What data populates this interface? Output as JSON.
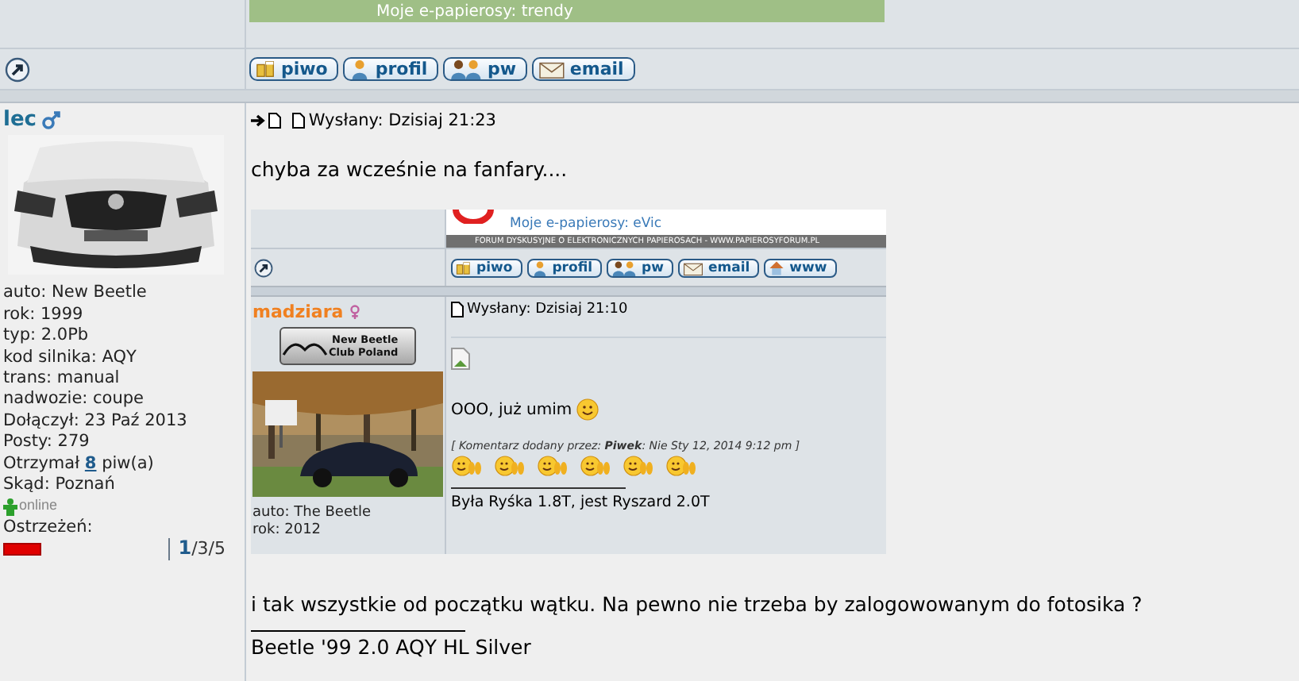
{
  "previous_post": {
    "signature_banner": "Moje e-papierosy: trendy",
    "buttons": [
      {
        "kind": "beer",
        "label": "piwo"
      },
      {
        "kind": "profile",
        "label": "profil"
      },
      {
        "kind": "pm",
        "label": "pw"
      },
      {
        "kind": "email",
        "label": "email"
      }
    ]
  },
  "post": {
    "author": "lec",
    "author_badge": {
      "kind": "male"
    },
    "profile_lines": [
      "auto: New Beetle",
      "rok: 1999",
      "typ: 2.0Pb",
      "kod silnika: AQY",
      "trans: manual",
      "nadwozie: coupe",
      "Dołączył: 23 Paź 2013",
      "Posty: 279"
    ],
    "beers": {
      "prefix": "Otrzymał",
      "count": "8",
      "suffix": "piw(a)"
    },
    "location": "Skąd: Poznań",
    "status": "online",
    "warnings_label": "Ostrzeżeń:",
    "warnings_count": "**1**/3/5",
    "posted": "Wysłany: Dzisiaj 21:23",
    "body_before": "chyba za wcześnie na fanfary....",
    "embedded_screenshot": {
      "banner_text": "Moje e-papierosy: eVic",
      "banner_footer": "FORUM DYSKUSYJNE O ELEKTRONICZNYCH PAPIEROSACH - WWW.PAPIEROSYFORUM.PL",
      "buttons": [
        {
          "kind": "beer",
          "label": "piwo"
        },
        {
          "kind": "profile",
          "label": "profil"
        },
        {
          "kind": "pm",
          "label": "pw"
        },
        {
          "kind": "email",
          "label": "email"
        },
        {
          "kind": "www",
          "label": "www"
        }
      ],
      "author": "madziara",
      "author_badge": {
        "kind": "female"
      },
      "club_badge": [
        "New Beetle",
        "Club Poland"
      ],
      "profile_lines": [
        "auto: The Beetle",
        "rok: 2012"
      ],
      "posted": "Wysłany: Dzisiaj 21:10",
      "message": "OOO, już umim",
      "comment": "[ Komentarz dodany przez: **Piwek**: Nie Sty 12, 2014 9:12 pm ]",
      "signature": "Była Ryśka 1.8T, jest Ryszard 2.0T"
    },
    "body_after": "i tak wszystkie od początku wątku. Na pewno nie trzeba by zalogowowanym do fotosika ?",
    "signature": "Beetle '99 2.0 AQY HL Silver"
  }
}
